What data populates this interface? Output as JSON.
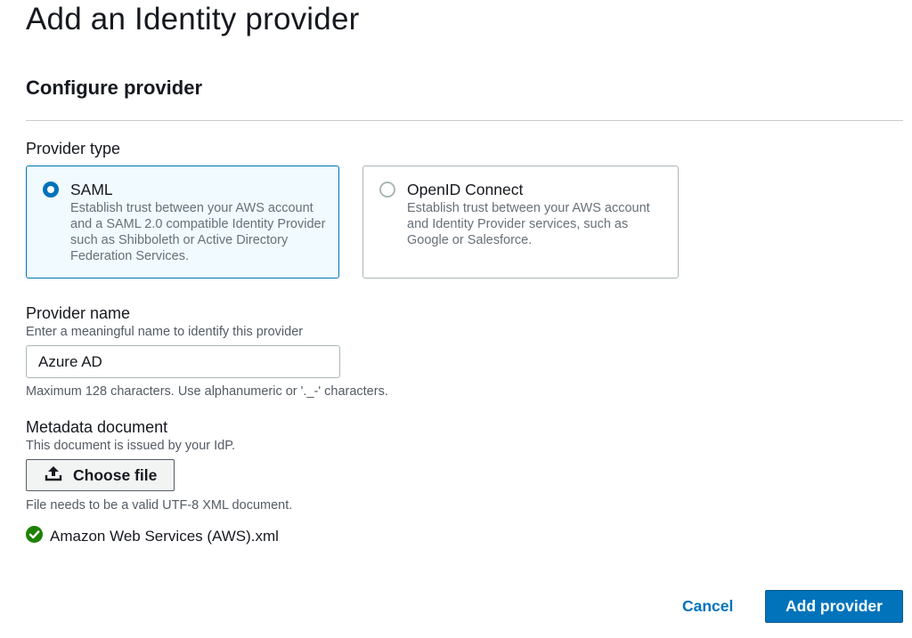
{
  "page": {
    "title": "Add an Identity provider",
    "section_title": "Configure provider"
  },
  "provider_type": {
    "label": "Provider type",
    "options": [
      {
        "title": "SAML",
        "description": "Establish trust between your AWS account and a SAML 2.0 compatible Identity Provider such as Shibboleth or Active Directory Federation Services.",
        "selected": true
      },
      {
        "title": "OpenID Connect",
        "description": "Establish trust between your AWS account and Identity Provider services, such as Google or Salesforce.",
        "selected": false
      }
    ]
  },
  "provider_name": {
    "label": "Provider name",
    "description": "Enter a meaningful name to identify this provider",
    "value": "Azure AD",
    "constraint": "Maximum 128 characters. Use alphanumeric or '._-' characters."
  },
  "metadata": {
    "label": "Metadata document",
    "description": "This document is issued by your IdP.",
    "choose_file_label": "Choose file",
    "constraint": "File needs to be a valid UTF-8 XML document.",
    "uploaded_file": "Amazon Web Services (AWS).xml",
    "upload_icon": "upload-icon",
    "success_icon": "check-circle-icon"
  },
  "actions": {
    "cancel_label": "Cancel",
    "submit_label": "Add provider"
  },
  "colors": {
    "accent": "#0073bb",
    "selected_tile_bg": "#f1faff",
    "success": "#1d8102"
  }
}
